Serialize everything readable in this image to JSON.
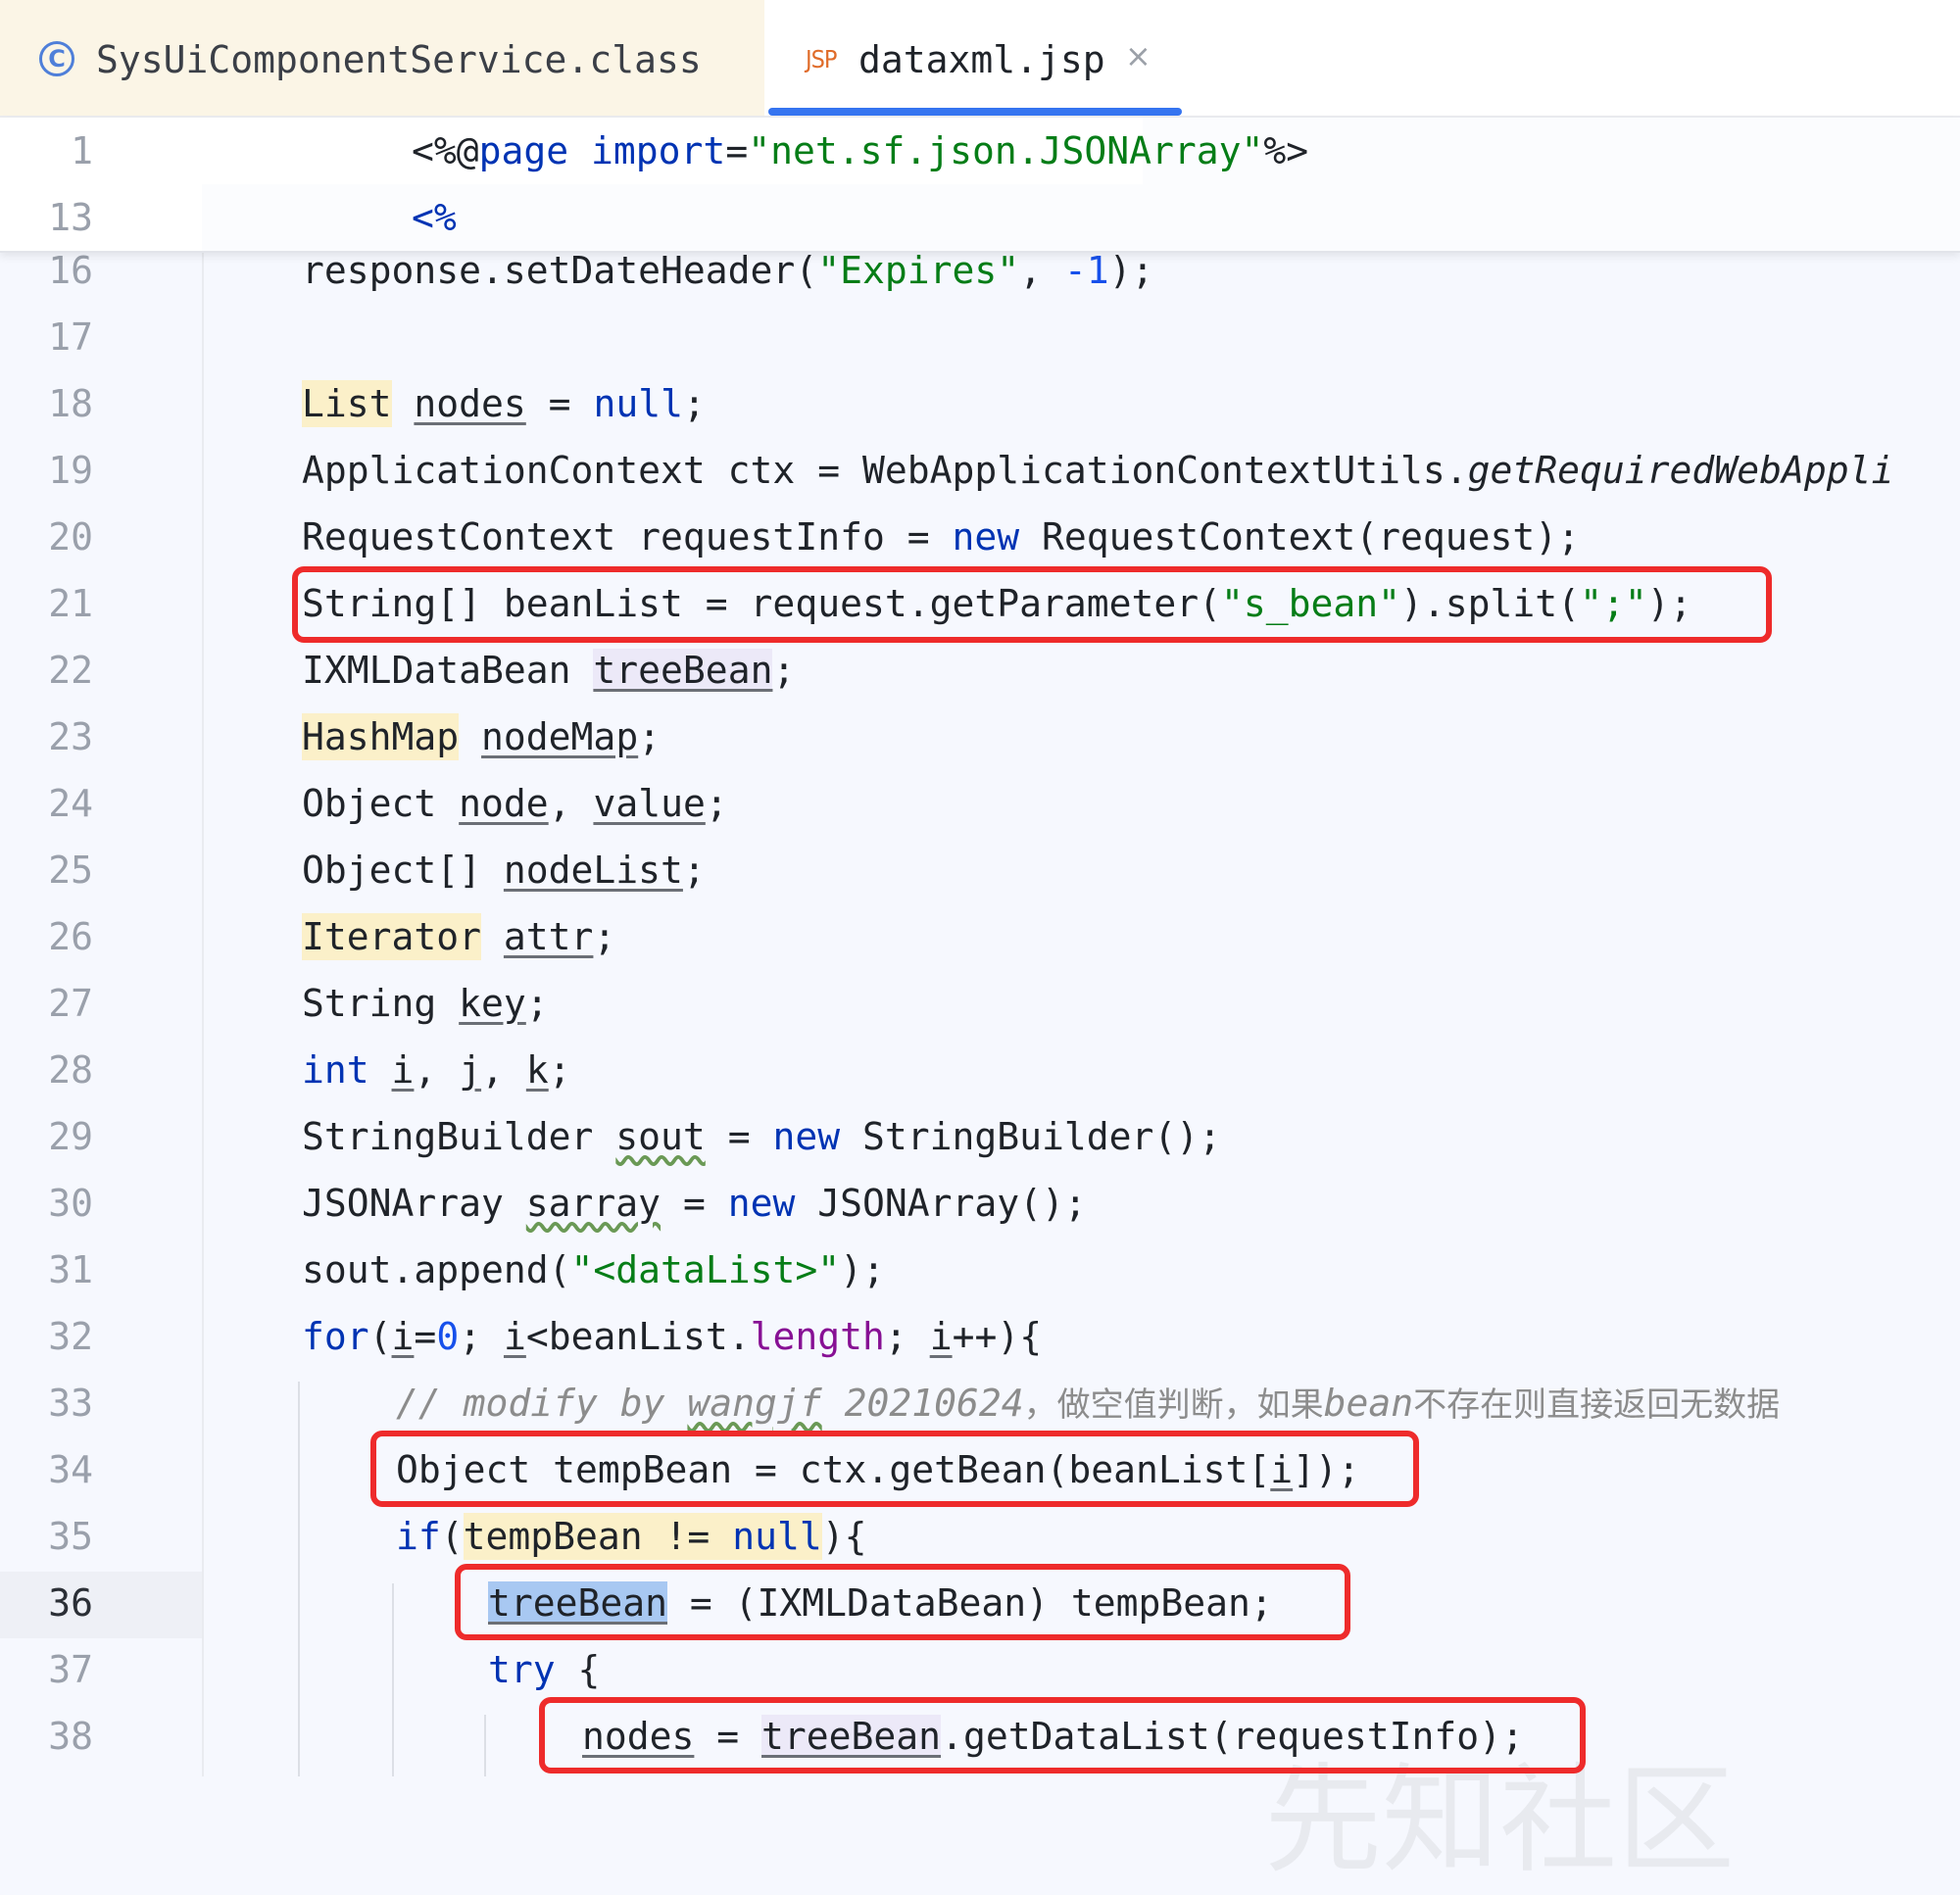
{
  "tabs": [
    {
      "label": "SysUiComponentService.class",
      "icon": "class-icon",
      "active": false
    },
    {
      "label": "dataxml.jsp",
      "icon": "jsp-file-icon",
      "icon_text": "JSP",
      "active": true,
      "close": "×"
    }
  ],
  "sticky_lines": [
    {
      "number": "1",
      "text": "<%@page import=\"net.sf.json.JSONArray\"%>"
    },
    {
      "number": "13",
      "text": "<%"
    }
  ],
  "lines": [
    {
      "number": "16",
      "text": "    response.setDateHeader(\"Expires\", -1);"
    },
    {
      "number": "17",
      "text": ""
    },
    {
      "number": "18",
      "text": "    List nodes = null;"
    },
    {
      "number": "19",
      "text": "    ApplicationContext ctx = WebApplicationContextUtils.getRequiredWebAppli"
    },
    {
      "number": "20",
      "text": "    RequestContext requestInfo = new RequestContext(request);"
    },
    {
      "number": "21",
      "text": "    String[] beanList = request.getParameter(\"s_bean\").split(\";\");"
    },
    {
      "number": "22",
      "text": "    IXMLDataBean treeBean;"
    },
    {
      "number": "23",
      "text": "    HashMap nodeMap;"
    },
    {
      "number": "24",
      "text": "    Object node, value;"
    },
    {
      "number": "25",
      "text": "    Object[] nodeList;"
    },
    {
      "number": "26",
      "text": "    Iterator attr;"
    },
    {
      "number": "27",
      "text": "    String key;"
    },
    {
      "number": "28",
      "text": "    int i, j, k;"
    },
    {
      "number": "29",
      "text": "    StringBuilder sout = new StringBuilder();"
    },
    {
      "number": "30",
      "text": "    JSONArray sarray = new JSONArray();"
    },
    {
      "number": "31",
      "text": "    sout.append(\"<dataList>\");"
    },
    {
      "number": "32",
      "text": "    for(i=0; i<beanList.length; i++){"
    },
    {
      "number": "33",
      "text": "        // modify by wangjf 20210624，做空值判断，如果bean不存在则直接返回无数据"
    },
    {
      "number": "34",
      "text": "        Object tempBean = ctx.getBean(beanList[i]);"
    },
    {
      "number": "35",
      "text": "        if(tempBean != null){"
    },
    {
      "number": "36",
      "text": "            treeBean = (IXMLDataBean) tempBean;"
    },
    {
      "number": "37",
      "text": "            try {"
    },
    {
      "number": "38",
      "text": "                nodes = treeBean.getDataList(requestInfo);"
    }
  ],
  "current_line": "36",
  "watermark": "先知社区",
  "colors": {
    "keyword": "#0033b3",
    "string": "#067d17",
    "number": "#1750eb",
    "field": "#871094",
    "comment": "#8c8c8c",
    "annotation_box": "#ee2b2b",
    "active_tab_underline": "#3574f0"
  }
}
